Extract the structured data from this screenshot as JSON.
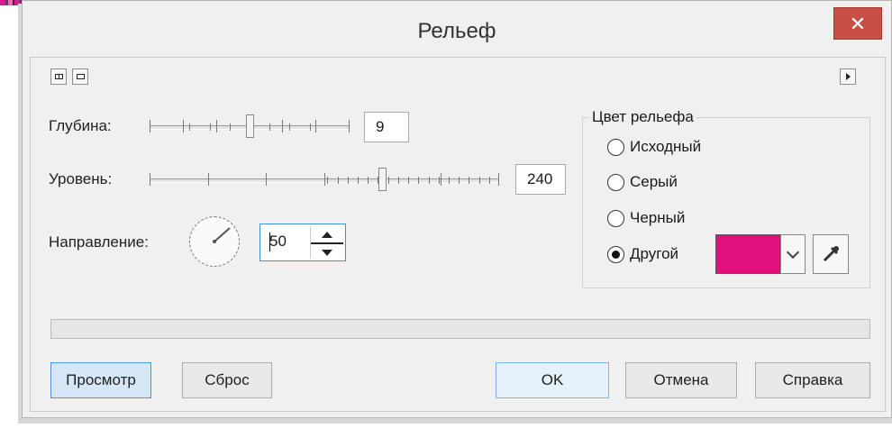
{
  "dialog": {
    "title": "Рельеф",
    "close_label": "✕"
  },
  "toolbar": {
    "split_view_icon": "split-view-icon",
    "single_view_icon": "single-view-icon",
    "expand_icon": "play-right-icon"
  },
  "controls": {
    "depth": {
      "label": "Глубина:",
      "value": "9",
      "level": 0.5
    },
    "level": {
      "label": "Уровень:",
      "value": "240",
      "level": 0.67
    },
    "direction": {
      "label": "Направление:",
      "value": "50"
    }
  },
  "color_group": {
    "title": "Цвет рельефа",
    "options": [
      {
        "label": "Исходный",
        "selected": false
      },
      {
        "label": "Серый",
        "selected": false
      },
      {
        "label": "Черный",
        "selected": false
      },
      {
        "label": "Другой",
        "selected": true
      }
    ],
    "custom_color": "#e0107f",
    "eyedropper_icon": "eyedropper-icon"
  },
  "progress": {
    "value": 0
  },
  "buttons": {
    "preview": "Просмотр",
    "reset": "Сброс",
    "ok": "OK",
    "cancel": "Отмена",
    "help": "Справка"
  }
}
